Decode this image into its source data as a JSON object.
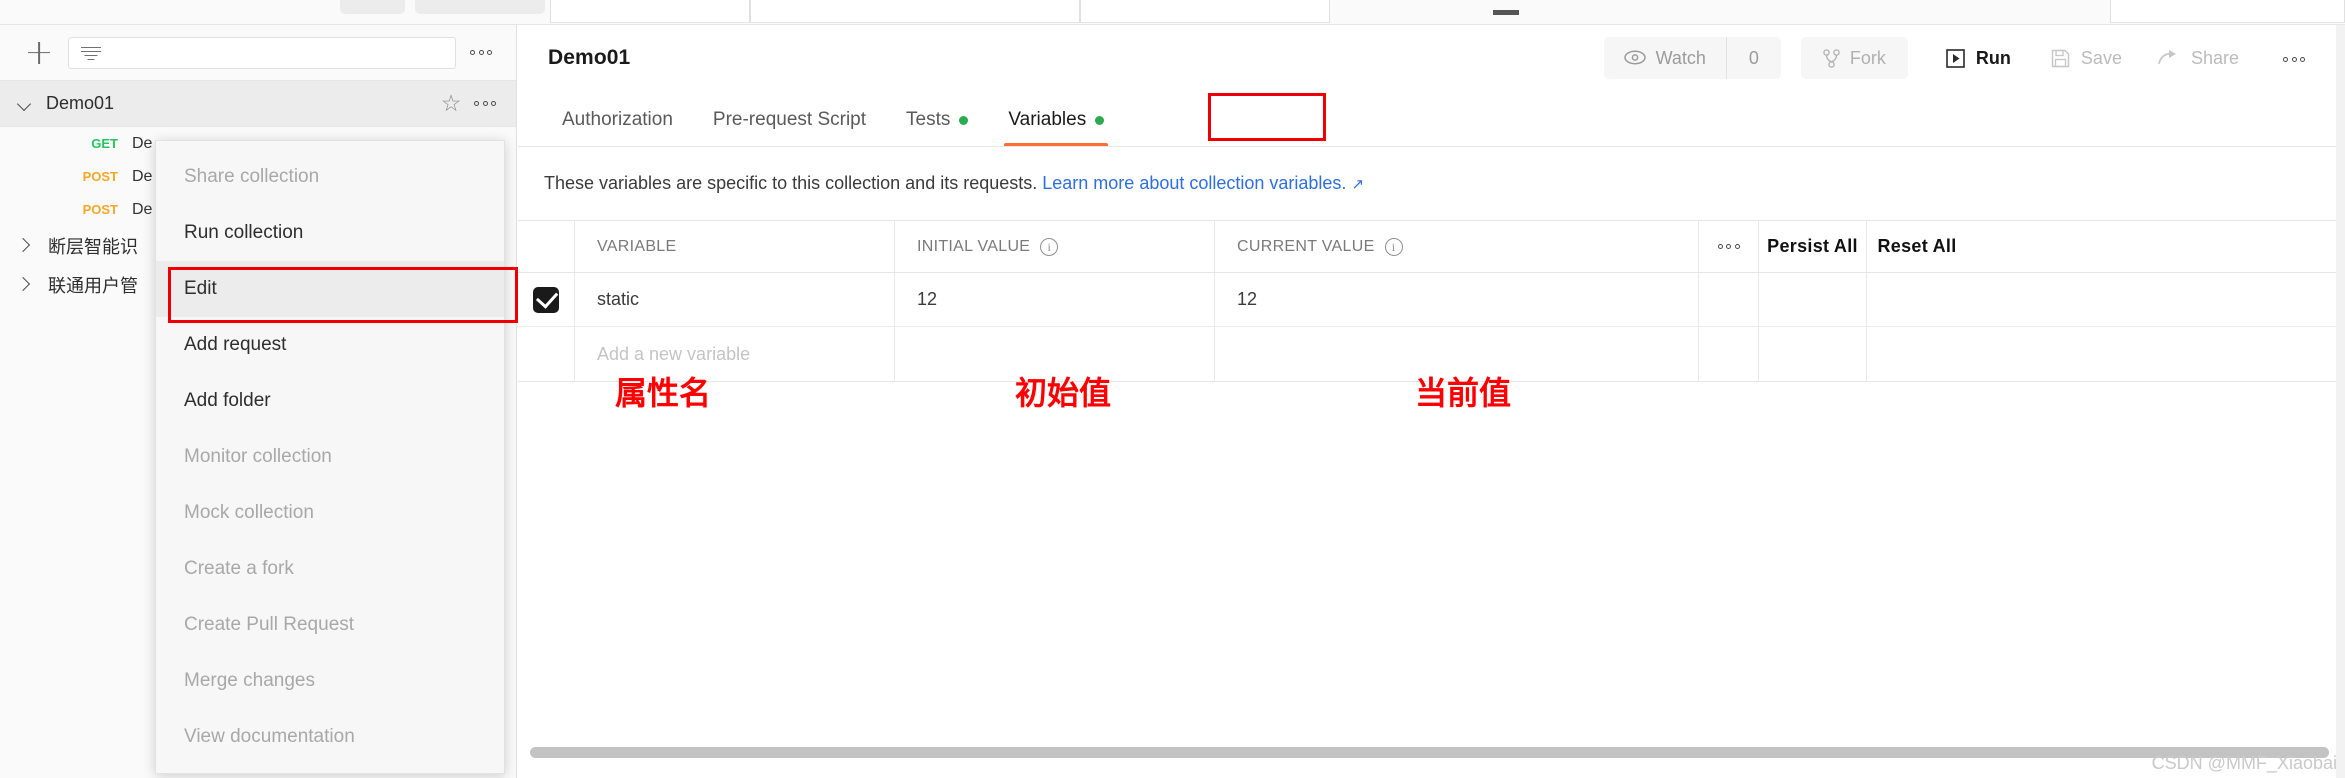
{
  "sidebar": {
    "add_button_icon": "plus-icon",
    "search": {
      "value": "",
      "placeholder": ""
    },
    "options_icon": "more-options-icon",
    "collection": {
      "name": "Demo01",
      "expanded": true,
      "star_icon": "star-icon",
      "options_icon": "more-options-icon"
    },
    "requests": [
      {
        "method": "GET",
        "name": "De"
      },
      {
        "method": "POST",
        "name": "De"
      },
      {
        "method": "POST",
        "name": "De"
      }
    ],
    "folders": [
      {
        "name": "断层智能识"
      },
      {
        "name": "联通用户管"
      }
    ]
  },
  "context_menu": {
    "items": [
      {
        "label": "Share collection",
        "disabled": true,
        "active": false
      },
      {
        "label": "Run collection",
        "disabled": false,
        "active": false
      },
      {
        "label": "Edit",
        "disabled": false,
        "active": true
      },
      {
        "label": "Add request",
        "disabled": false,
        "active": false
      },
      {
        "label": "Add folder",
        "disabled": false,
        "active": false
      },
      {
        "label": "Monitor collection",
        "disabled": true,
        "active": false
      },
      {
        "label": "Mock collection",
        "disabled": true,
        "active": false
      },
      {
        "label": "Create a fork",
        "disabled": true,
        "active": false
      },
      {
        "label": "Create Pull Request",
        "disabled": true,
        "active": false
      },
      {
        "label": "Merge changes",
        "disabled": true,
        "active": false
      },
      {
        "label": "View documentation",
        "disabled": true,
        "active": false
      }
    ],
    "highlight_color": "#ee0000"
  },
  "main": {
    "title": "Demo01",
    "toolbar": {
      "watch_label": "Watch",
      "watch_count": "0",
      "fork_label": "Fork",
      "run_label": "Run",
      "save_label": "Save",
      "share_label": "Share",
      "options_icon": "more-options-icon"
    },
    "tabs": [
      {
        "label": "Authorization",
        "dot": false,
        "selected": false
      },
      {
        "label": "Pre-request Script",
        "dot": false,
        "selected": false
      },
      {
        "label": "Tests",
        "dot": true,
        "selected": false
      },
      {
        "label": "Variables",
        "dot": true,
        "selected": true
      }
    ],
    "tab_accent_color": "#ff6c37",
    "tab_dot_color": "#2aab4f",
    "description": {
      "text": "These variables are specific to this collection and its requests.",
      "link_text": "Learn more about collection variables.",
      "link_arrow": "↗",
      "link_color": "#2e6ee0"
    },
    "table": {
      "headers": {
        "variable": "VARIABLE",
        "initial_value": "INITIAL VALUE",
        "current_value": "CURRENT VALUE",
        "persist_all": "Persist All",
        "reset_all": "Reset All",
        "options_icon": "more-options-icon",
        "info_icon": "info-icon"
      },
      "rows": [
        {
          "checked": true,
          "variable": "static",
          "initial_value": "12",
          "current_value": "12"
        }
      ],
      "new_row_placeholder": "Add a new variable"
    },
    "annotations": [
      {
        "text": "属性名",
        "target": "variable-column"
      },
      {
        "text": "初始值",
        "target": "initial-value-column"
      },
      {
        "text": "当前值",
        "target": "current-value-column"
      }
    ],
    "annotation_color": "#ff0000"
  },
  "watermark": "CSDN @MMF_Xiaobai"
}
